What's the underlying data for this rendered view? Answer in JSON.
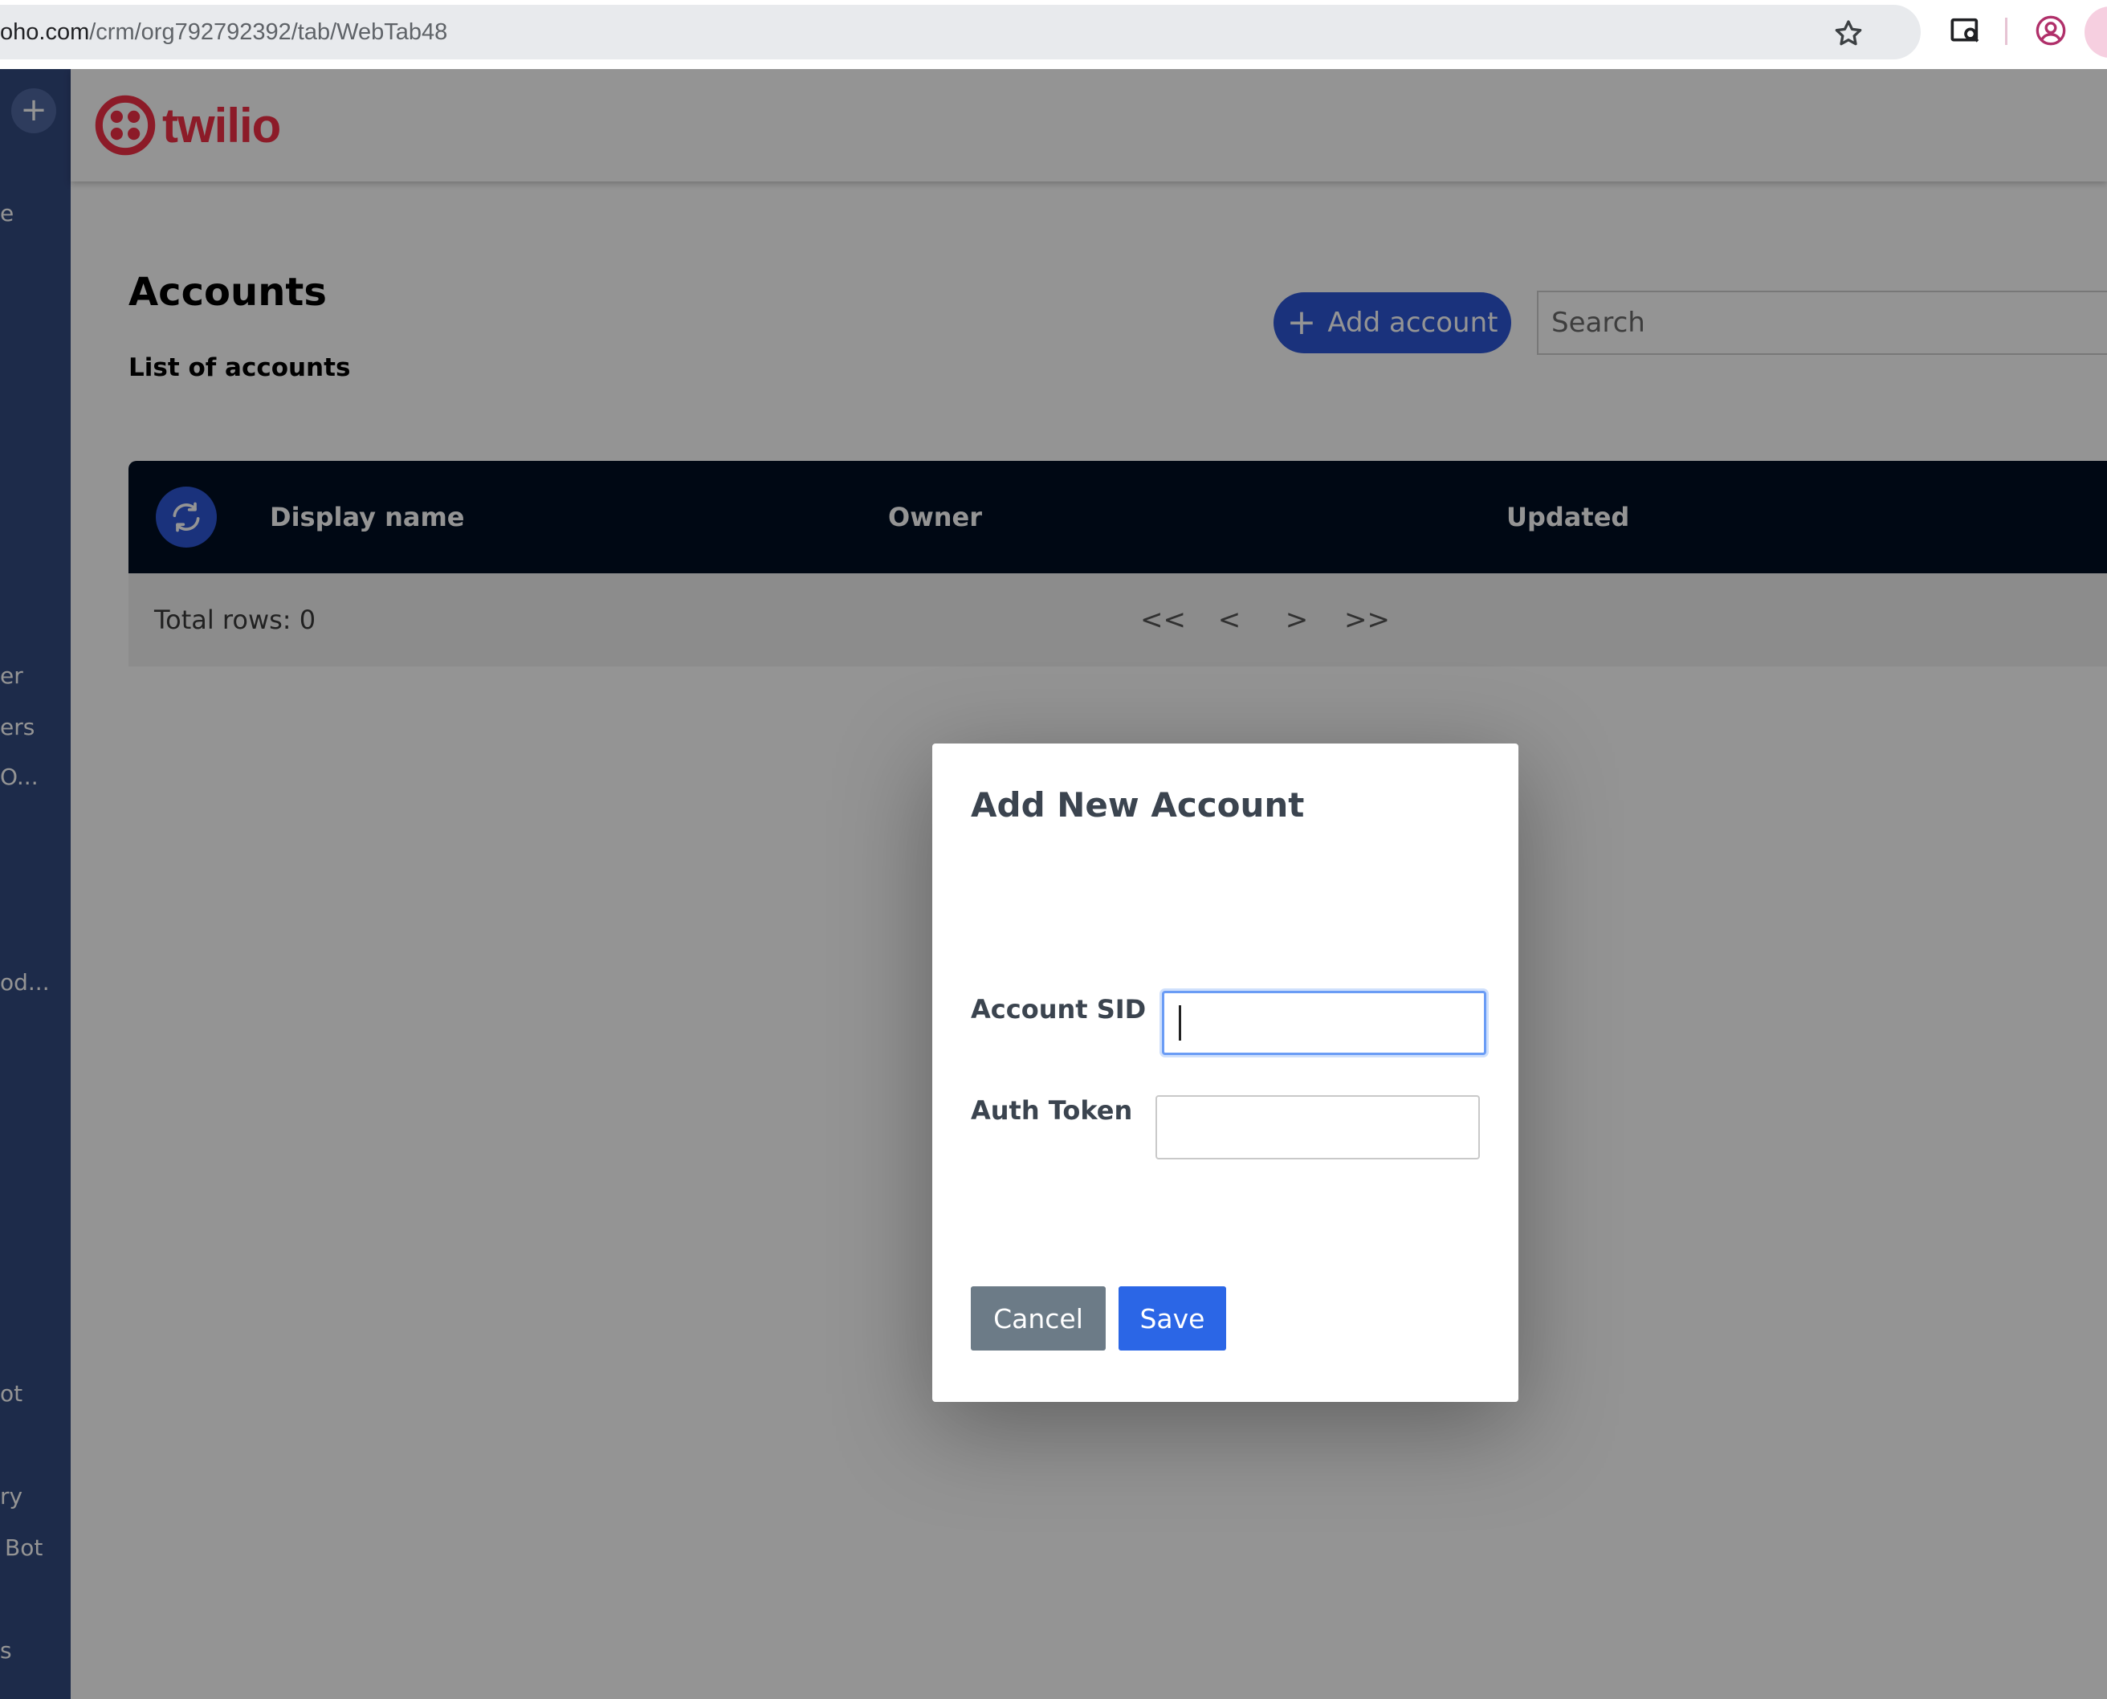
{
  "browser": {
    "url_host": "oho.com",
    "url_path": "/crm/org792792392/tab/WebTab48"
  },
  "sidebar": {
    "items": [
      {
        "label": "e"
      },
      {
        "label": "er"
      },
      {
        "label": "ers"
      },
      {
        "label": "O..."
      },
      {
        "label": "od..."
      },
      {
        "label": "ot"
      },
      {
        "label": "ry"
      },
      {
        "label": "Bot"
      },
      {
        "label": "s"
      }
    ]
  },
  "header": {
    "brand": "twilio"
  },
  "page": {
    "title": "Accounts",
    "subtitle": "List of accounts",
    "add_account_label": "Add account",
    "search_placeholder": "Search"
  },
  "table": {
    "columns": [
      "Display name",
      "Owner",
      "Updated"
    ],
    "total_rows_label": "Total rows: 0",
    "pager": {
      "first": "<<",
      "prev": "<",
      "next": ">",
      "last": ">>"
    }
  },
  "modal": {
    "title": "Add New Account",
    "fields": [
      {
        "label": "Account SID",
        "value": ""
      },
      {
        "label": "Auth Token",
        "value": ""
      }
    ],
    "cancel_label": "Cancel",
    "save_label": "Save"
  },
  "colors": {
    "brand_red": "#f22f46",
    "primary_blue": "#2d56d6",
    "table_header": "#000e24",
    "sidebar": "#334a80",
    "cancel_gray": "#6c7b87"
  }
}
